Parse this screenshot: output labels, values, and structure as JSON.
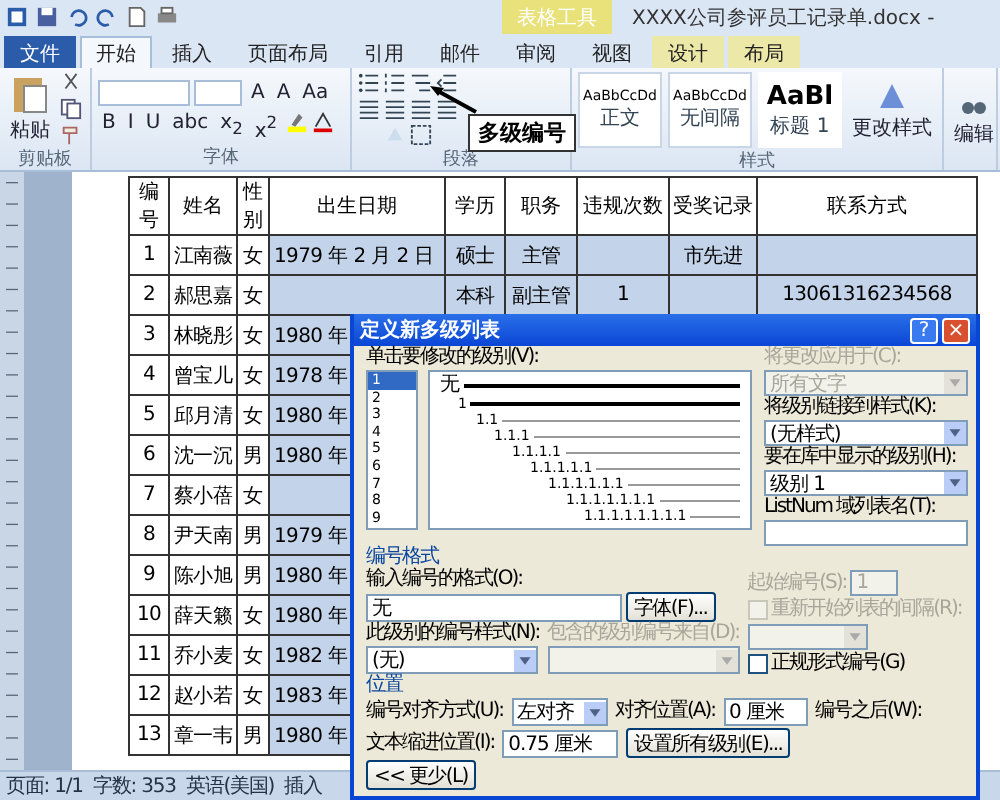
{
  "window": {
    "title": "XXXX公司参评员工记录单.docx -",
    "context_tab": "表格工具"
  },
  "tabs": [
    {
      "label": "文件",
      "kind": "file",
      "selected": false
    },
    {
      "label": "开始",
      "kind": "tab",
      "selected": true
    },
    {
      "label": "插入",
      "kind": "tab",
      "selected": false
    },
    {
      "label": "页面布局",
      "kind": "tab",
      "selected": false
    },
    {
      "label": "引用",
      "kind": "tab",
      "selected": false
    },
    {
      "label": "邮件",
      "kind": "tab",
      "selected": false
    },
    {
      "label": "审阅",
      "kind": "tab",
      "selected": false
    },
    {
      "label": "视图",
      "kind": "tab",
      "selected": false
    },
    {
      "label": "设计",
      "kind": "context",
      "selected": false
    },
    {
      "label": "布局",
      "kind": "context",
      "selected": false
    }
  ],
  "ribbon": {
    "paste": "粘贴",
    "font_buttons": [
      "A",
      "A",
      "Aa"
    ],
    "format_buttons": [
      "B",
      "I",
      "U",
      "abc",
      "x$_{2}$",
      "x$^{2}$"
    ],
    "styles": [
      {
        "sample": "AaBbCcDd",
        "name": "正文",
        "kind": "small"
      },
      {
        "sample": "AaBbCcDd",
        "name": "无间隔",
        "kind": "small"
      },
      {
        "sample": "AaBl",
        "name": "标题 1",
        "kind": "big"
      }
    ],
    "change_styles": "更改样式",
    "edit": "编辑",
    "groups": [
      "剪贴板",
      "字体",
      "段落",
      "样式"
    ],
    "tooltip": "多级编号"
  },
  "table": {
    "columns": [
      "编号",
      "姓名",
      "性别",
      "出生日期",
      "学历",
      "职务",
      "违规次数",
      "受奖记录",
      "联系方式"
    ],
    "rows": [
      {
        "selected": true,
        "cells": [
          "1",
          "江南薇",
          "女",
          "1979 年 2 月 2 日",
          "硕士",
          "主管",
          "",
          "市先进",
          ""
        ]
      },
      {
        "selected": true,
        "cells": [
          "2",
          "郝思嘉",
          "女",
          "",
          "本科",
          "副主管",
          "1",
          "",
          "13061316234568"
        ]
      },
      {
        "selected": true,
        "cells": [
          "3",
          "林晓彤",
          "女",
          "1980 年"
        ]
      },
      {
        "selected": true,
        "cells": [
          "4",
          "曾宝儿",
          "女",
          "1978 年"
        ]
      },
      {
        "selected": true,
        "cells": [
          "5",
          "邱月清",
          "女",
          "1980 年"
        ]
      },
      {
        "selected": true,
        "cells": [
          "6",
          "沈一沉",
          "男",
          "1980 年"
        ]
      },
      {
        "selected": true,
        "cells": [
          "7",
          "蔡小蓓",
          "女",
          ""
        ]
      },
      {
        "selected": true,
        "cells": [
          "8",
          "尹天南",
          "男",
          "1979 年"
        ]
      },
      {
        "selected": true,
        "cells": [
          "9",
          "陈小旭",
          "男",
          "1980 年"
        ]
      },
      {
        "selected": true,
        "cells": [
          "10",
          "薛天籁",
          "女",
          "1980 年"
        ]
      },
      {
        "selected": true,
        "cells": [
          "11",
          "乔小麦",
          "女",
          "1982 年"
        ]
      },
      {
        "selected": true,
        "cells": [
          "12",
          "赵小若",
          "女",
          "1983 年"
        ]
      },
      {
        "selected": true,
        "cells": [
          "13",
          "章一韦",
          "男",
          "1980 年"
        ]
      }
    ]
  },
  "status_bar": [
    "页面: 1/1",
    "字数: 353",
    "英语(美国)",
    "插入"
  ],
  "dialog": {
    "title": "定义新多级列表",
    "help": "?",
    "close": "×",
    "level_label": "单击要修改的级别(V):",
    "levels": [
      {
        "label": "1",
        "selected": true
      },
      {
        "label": "2",
        "selected": false
      },
      {
        "label": "3",
        "selected": false
      },
      {
        "label": "4",
        "selected": false
      },
      {
        "label": "5",
        "selected": false
      },
      {
        "label": "6",
        "selected": false
      },
      {
        "label": "7",
        "selected": false
      },
      {
        "label": "8",
        "selected": false
      },
      {
        "label": "9",
        "selected": false
      }
    ],
    "preview": [
      "无",
      "1",
      "1.1",
      "1.1.1",
      "1.1.1.1",
      "1.1.1.1.1",
      "1.1.1.1.1.1",
      "1.1.1.1.1.1.1",
      "1.1.1.1.1.1.1.1"
    ],
    "right": [
      {
        "label": "将更改应用于(C):",
        "value": "所有文字",
        "disabled": true
      },
      {
        "label": "将级别链接到样式(K):",
        "value": "(无样式)",
        "disabled": false
      },
      {
        "label": "要在库中显示的级别(H):",
        "value": "级别 1",
        "disabled": false
      }
    ],
    "listnum_label": "ListNum 域列表名(T):",
    "format_heading": "编号格式",
    "format_label": "输入编号的格式(O):",
    "format_value": "无",
    "font_button": "字体(F)...",
    "start_label": "起始编号(S):",
    "start_value": "1",
    "restart": {
      "label": "重新开始列表的间隔(R):",
      "checked": false,
      "disabled": true
    },
    "style_label": "此级别的编号样式(N):",
    "style_value": "(无)",
    "include_label": "包含的级别编号来自(D):",
    "legal": {
      "label": "正规形式编号(G)",
      "checked": false
    },
    "position_heading": "位置",
    "align_label": "编号对齐方式(U):",
    "align_value": "左对齐",
    "at_label": "对齐位置(A):",
    "at_value": "0 厘米",
    "after_label": "编号之后(W):",
    "indent_label": "文本缩进位置(I):",
    "indent_value": "0.75 厘米",
    "set_all": "设置所有级别(E)...",
    "less": "<< 更少(L)"
  }
}
